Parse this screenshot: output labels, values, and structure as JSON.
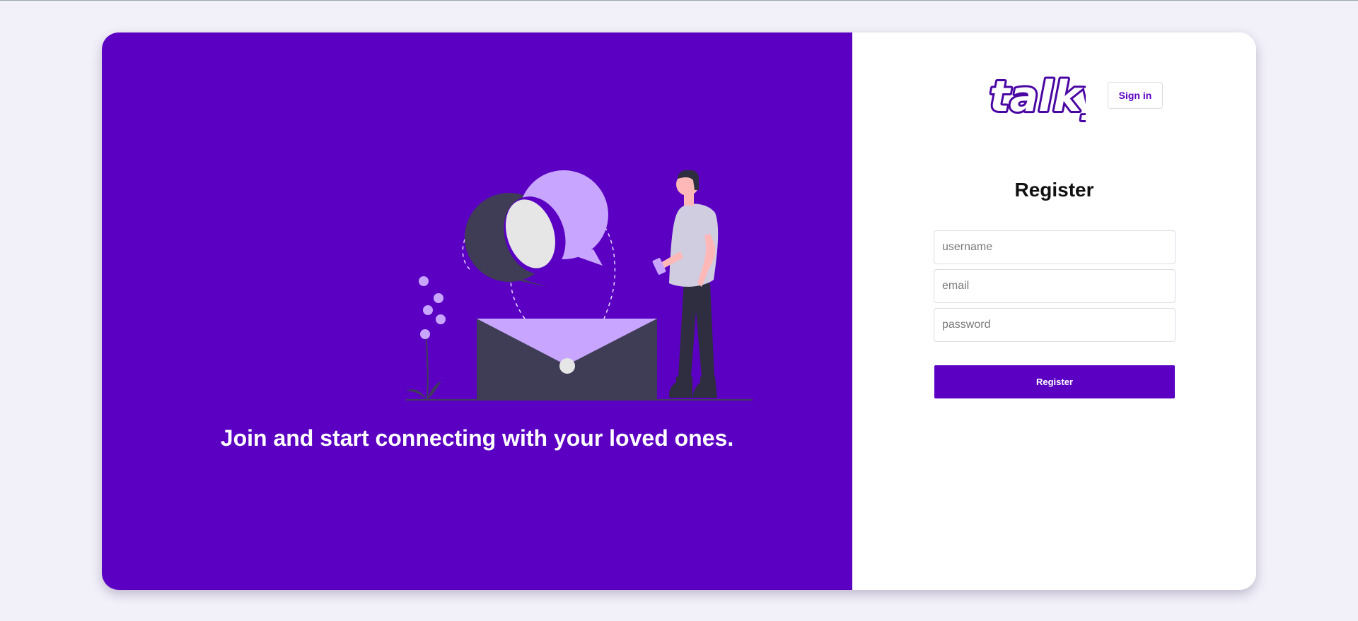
{
  "app": {
    "logo_text": "talky",
    "colors": {
      "brand": "#5b00c3",
      "page_background": "#f2f1fa",
      "panel_white": "#ffffff",
      "illustration_dark": "#3f3d56",
      "illustration_light": "#c8a6ff",
      "illustration_skin": "#ffb8b8"
    }
  },
  "hero": {
    "tagline": "Join and start connecting with your loved ones.",
    "illustration": "person-messaging-envelope-illustration"
  },
  "header": {
    "signin_label": "Sign in"
  },
  "form": {
    "title": "Register",
    "username_placeholder": "username",
    "email_placeholder": "email",
    "password_placeholder": "password",
    "submit_label": "Register"
  }
}
